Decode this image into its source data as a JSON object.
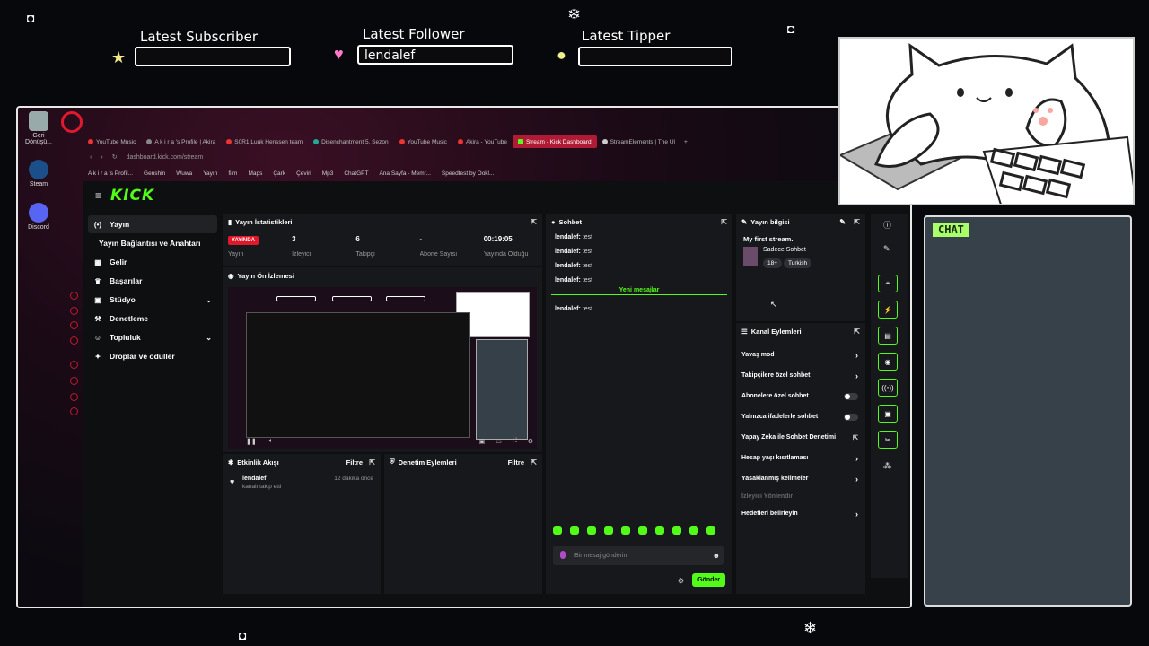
{
  "overlay": {
    "alerts": [
      {
        "title": "Latest Subscriber",
        "value": "",
        "icon": "star-icon"
      },
      {
        "title": "Latest Follower",
        "value": "lendalef",
        "icon": "heart-icon"
      },
      {
        "title": "Latest Tipper",
        "value": "",
        "icon": "coin-icon"
      }
    ],
    "chat_label": "CHAT"
  },
  "desktop": {
    "icons": [
      {
        "label": "Geri Dönüşü..."
      },
      {
        "label": "Steam"
      },
      {
        "label": "Discord"
      }
    ]
  },
  "browser": {
    "tabs": [
      {
        "label": "YouTube Music",
        "active": false
      },
      {
        "label": "A k i r a 's Profile | Akira",
        "active": false
      },
      {
        "label": "S0R1 Luuk Henssen team",
        "active": false
      },
      {
        "label": "Disenchantment 5. Sezon",
        "active": false
      },
      {
        "label": "YouTube Music",
        "active": false
      },
      {
        "label": "Akira - YouTube",
        "active": false
      },
      {
        "label": "Stream - Kick Dashboard",
        "active": true
      },
      {
        "label": "StreamElements | The Ul",
        "active": false
      }
    ],
    "url": "dashboard.kick.com/stream",
    "bookmarks": [
      "A k i r a 's Profil...",
      "Genshin",
      "Wuwa",
      "Yayın",
      "film",
      "Maps",
      "Çark",
      "Çeviri",
      "Mp3",
      "ChatGPT",
      "Ana Sayfa - Memr...",
      "Speedtest by Ookl..."
    ]
  },
  "kick": {
    "logo": "KICK",
    "nav": [
      {
        "label": "Yayın",
        "icon": "broadcast-icon",
        "active": true,
        "sub": false,
        "chevron": false
      },
      {
        "label": "Yayın Bağlantısı ve Anahtarı",
        "icon": "",
        "active": false,
        "sub": true,
        "chevron": false
      },
      {
        "label": "Gelir",
        "icon": "grid-icon",
        "active": false,
        "sub": false,
        "chevron": false
      },
      {
        "label": "Başarılar",
        "icon": "trophy-icon",
        "active": false,
        "sub": false,
        "chevron": false
      },
      {
        "label": "Stüdyo",
        "icon": "studio-icon",
        "active": false,
        "sub": false,
        "chevron": true
      },
      {
        "label": "Denetleme",
        "icon": "hammer-icon",
        "active": false,
        "sub": false,
        "chevron": false
      },
      {
        "label": "Topluluk",
        "icon": "people-icon",
        "active": false,
        "sub": false,
        "chevron": true
      },
      {
        "label": "Droplar ve ödüller",
        "icon": "gift-icon",
        "active": false,
        "sub": false,
        "chevron": false
      }
    ],
    "stats": {
      "title": "Yayın İstatistikleri",
      "items": [
        {
          "value": "YAYINDA",
          "label": "Yayın",
          "live": true
        },
        {
          "value": "3",
          "label": "İzleyici",
          "live": false
        },
        {
          "value": "6",
          "label": "Takipçi",
          "live": false
        },
        {
          "value": "-",
          "label": "Abone Sayısı",
          "live": false
        },
        {
          "value": "00:19:05",
          "label": "Yayında Olduğu",
          "live": false
        }
      ]
    },
    "preview": {
      "title": "Yayın Ön İzlemesi"
    },
    "activity": {
      "title": "Etkinlik Akışı",
      "filter": "Filtre",
      "items": [
        {
          "user": "lendalef",
          "action": "kanalı takip etti",
          "time": "12 dakika önce"
        }
      ]
    },
    "moderation": {
      "title": "Denetim Eylemleri",
      "filter": "Filtre"
    },
    "chat": {
      "title": "Sohbet",
      "messages_before": [
        {
          "user": "lendalef:",
          "text": "test"
        },
        {
          "user": "lendalef:",
          "text": "test"
        },
        {
          "user": "lendalef:",
          "text": "test"
        },
        {
          "user": "lendalef:",
          "text": "test"
        }
      ],
      "new_messages": "Yeni mesajlar",
      "messages_after": [
        {
          "user": "lendalef:",
          "text": "test"
        }
      ],
      "placeholder": "Bir mesaj gönderin",
      "send": "Gönder"
    },
    "stream_info": {
      "title": "Yayın bilgisi",
      "stream_title": "My first stream.",
      "category": "Sadece Sohbet",
      "tags": [
        "18+",
        "Turkish"
      ]
    },
    "channel_actions": {
      "title": "Kanal Eylemleri",
      "items": [
        {
          "label": "Yavaş mod",
          "control": "chevron"
        },
        {
          "label": "Takipçilere özel sohbet",
          "control": "chevron"
        },
        {
          "label": "Abonelere özel sohbet",
          "control": "toggle"
        },
        {
          "label": "Yalnızca ifadelerle sohbet",
          "control": "toggle"
        },
        {
          "label": "Yapay Zeka ile Sohbet Denetimi",
          "control": "external"
        },
        {
          "label": "Hesap yaşı kısıtlaması",
          "control": "chevron"
        },
        {
          "label": "Yasaklanmış kelimeler",
          "control": "chevron"
        },
        {
          "label": "İzleyici Yönlendir",
          "control": "none"
        },
        {
          "label": "Hedefleri belirleyin",
          "control": "chevron"
        }
      ]
    }
  }
}
